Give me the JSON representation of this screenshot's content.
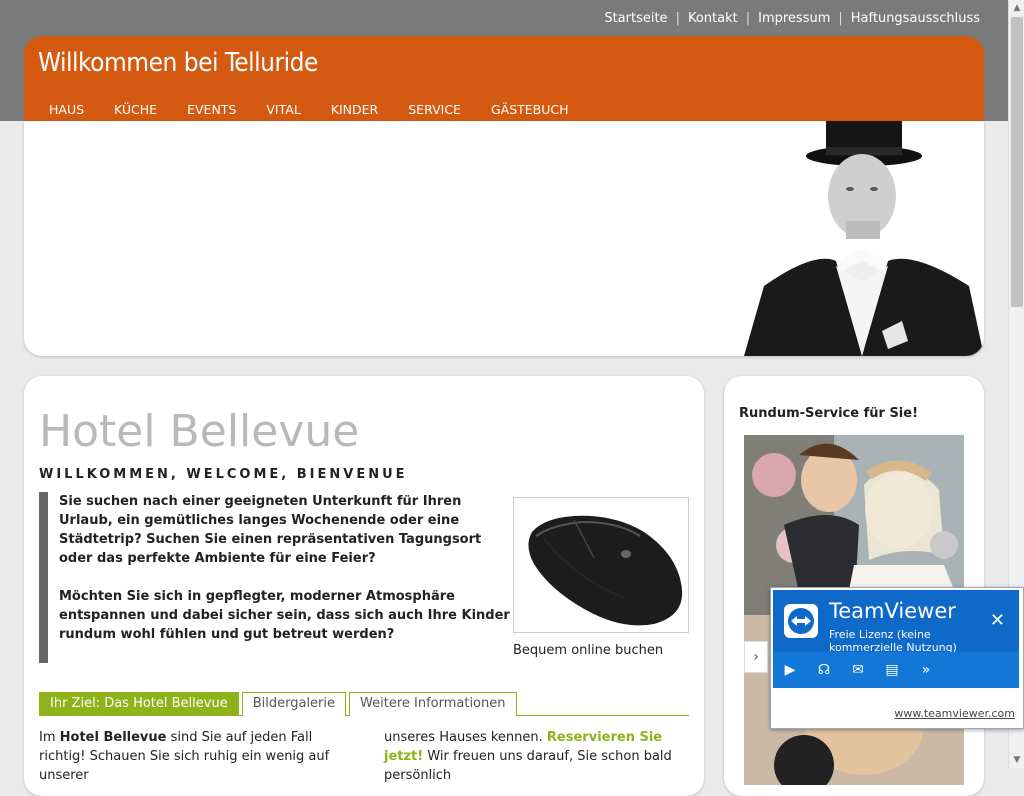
{
  "top_links": [
    "Startseite",
    "Kontakt",
    "Impressum",
    "Haftungsausschluss"
  ],
  "header": {
    "title": "Willkommen bei Telluride",
    "nav": [
      "HAUS",
      "KÜCHE",
      "EVENTS",
      "VITAL",
      "KINDER",
      "SERVICE",
      "GÄSTEBUCH"
    ],
    "brand_color": "#d45a12"
  },
  "main": {
    "title": "Hotel Bellevue",
    "subtitle": "WILLKOMMEN, WELCOME, BIENVENUE",
    "para1": "Sie suchen nach einer geeigneten Unterkunft für Ihren Urlaub, ein gemütliches langes Wochenende oder eine Städtetrip? Suchen Sie einen repräsentativen Tagungsort oder das perfekte Ambiente für eine Feier?",
    "para2": "Möchten Sie sich in gepflegter, moderner Atmosphäre entspannen und dabei sicher sein, dass sich auch Ihre Kinder rundum wohl fühlen und gut betreut werden?",
    "image_caption": "Bequem online buchen",
    "tabs": [
      "Ihr Ziel: Das Hotel Bellevue",
      "Bildergalerie",
      "Weitere Informationen"
    ],
    "body_left_1": "Im ",
    "body_left_bold": "Hotel Bellevue",
    "body_left_2": " sind Sie auf jeden Fall richtig! Schauen Sie sich ruhig ein wenig auf unserer",
    "body_right_1": "unseres Hauses kennen. ",
    "body_right_link": "Reservieren Sie jetzt!",
    "body_right_2": " Wir freuen uns darauf, Sie schon bald persönlich",
    "accent_color": "#8db21a"
  },
  "sidebar": {
    "title": "Rundum-Service für Sie!"
  },
  "teamviewer": {
    "brand": "TeamViewer",
    "license": "Freie Lizenz (keine kommerzielle Nutzung)",
    "link": "www.teamviewer.com",
    "close": "✕",
    "more": "»"
  }
}
